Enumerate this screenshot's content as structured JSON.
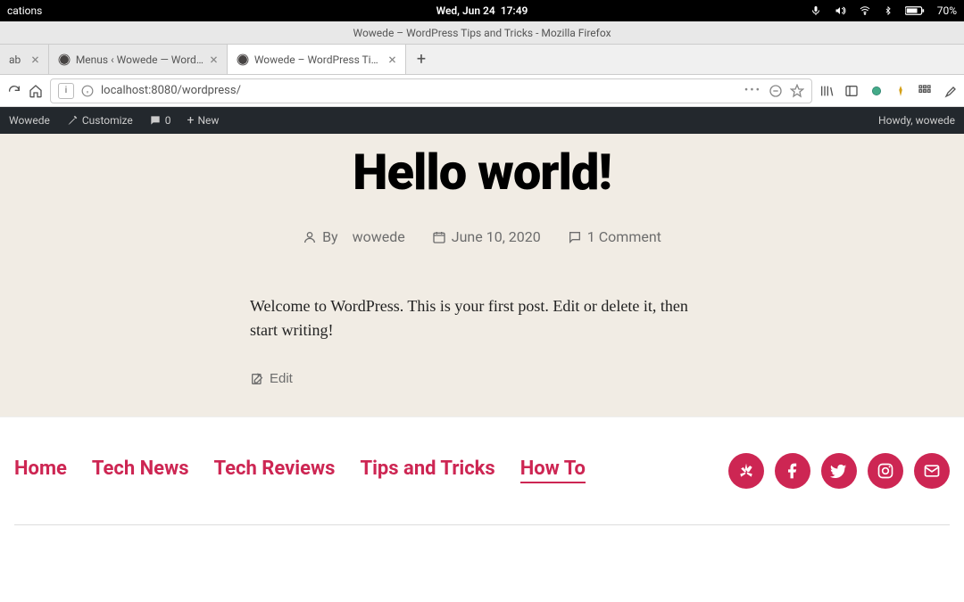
{
  "os_menubar": {
    "left": "cations",
    "date": "Wed, Jun 24",
    "time": "17:49",
    "battery": "70%"
  },
  "browser": {
    "window_title": "Wowede – WordPress Tips and Tricks - Mozilla Firefox",
    "tabs": [
      {
        "label": "ab"
      },
      {
        "label": "Menus ‹ Wowede — WordPr"
      },
      {
        "label": "Wowede – WordPress Tips a"
      }
    ],
    "url": "localhost:8080/wordpress/",
    "url_badge": "i",
    "menu_dots": "•••"
  },
  "wp_admin": {
    "site": "Wowede",
    "customize": "Customize",
    "comment_count": "0",
    "new": "New",
    "howdy": "Howdy, wowede"
  },
  "post": {
    "title": "Hello world!",
    "by_label": "By",
    "author": "wowede",
    "date": "June 10, 2020",
    "comments": "1 Comment",
    "content": "Welcome to WordPress. This is your first post. Edit or delete it, then start writing!",
    "edit": "Edit"
  },
  "footer_nav": {
    "items": [
      "Home",
      "Tech News",
      "Tech Reviews",
      "Tips and Tricks",
      "How To"
    ]
  }
}
